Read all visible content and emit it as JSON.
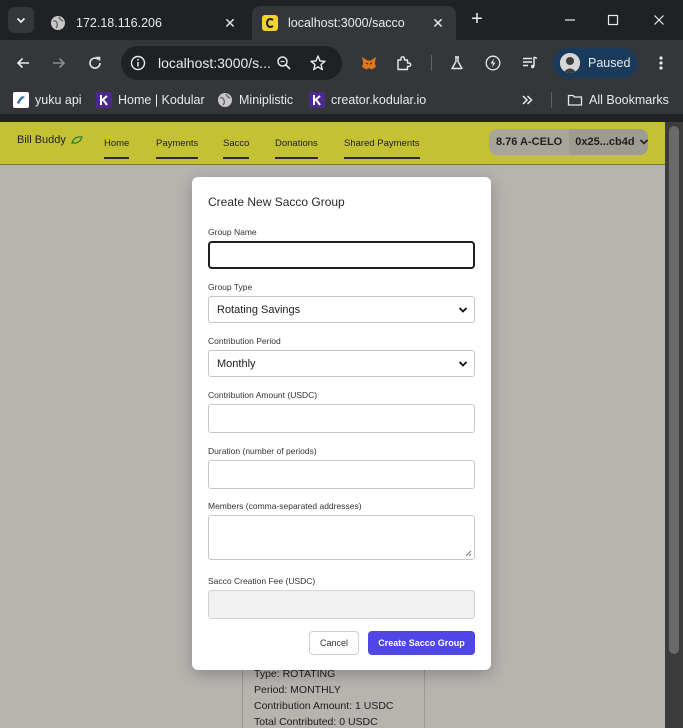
{
  "browser": {
    "tabs": [
      {
        "title": "172.18.116.206",
        "active": false
      },
      {
        "title": "localhost:3000/sacco",
        "active": true
      }
    ],
    "url": "localhost:3000/s...",
    "profile_label": "Paused",
    "bookmarks": [
      {
        "label": "yuku api",
        "icon": "yuku-logo-icon"
      },
      {
        "label": "Home | Kodular",
        "icon": "kodular-k-icon"
      },
      {
        "label": "Miniplistic",
        "icon": "globe-icon"
      },
      {
        "label": "creator.kodular.io",
        "icon": "kodular-k-icon"
      }
    ],
    "all_bookmarks_label": "All Bookmarks"
  },
  "app": {
    "brand": "Bill Buddy",
    "nav": [
      "Home",
      "Payments",
      "Sacco",
      "Donations",
      "Shared Payments"
    ],
    "wallet": {
      "balance": "8.76 A-CELO",
      "address": "0x25...cb4d"
    },
    "accent_color": "#c4c233"
  },
  "background_card": {
    "lines": [
      "Type: ROTATING",
      "Period: MONTHLY",
      "Contribution Amount: 1 USDC",
      "Total Contributed: 0 USDC"
    ]
  },
  "modal": {
    "title": "Create New Sacco Group",
    "fields": {
      "group_name": {
        "label": "Group Name",
        "value": ""
      },
      "group_type": {
        "label": "Group Type",
        "value": "Rotating Savings"
      },
      "contribution_period": {
        "label": "Contribution Period",
        "value": "Monthly"
      },
      "contribution_amount": {
        "label": "Contribution Amount (USDC)",
        "value": ""
      },
      "duration": {
        "label": "Duration (number of periods)",
        "value": ""
      },
      "members": {
        "label": "Members (comma-separated addresses)",
        "value": ""
      },
      "creation_fee": {
        "label": "Sacco Creation Fee (USDC)",
        "value": ""
      }
    },
    "cancel_label": "Cancel",
    "create_label": "Create Sacco Group",
    "primary_color": "#4f46e5"
  }
}
